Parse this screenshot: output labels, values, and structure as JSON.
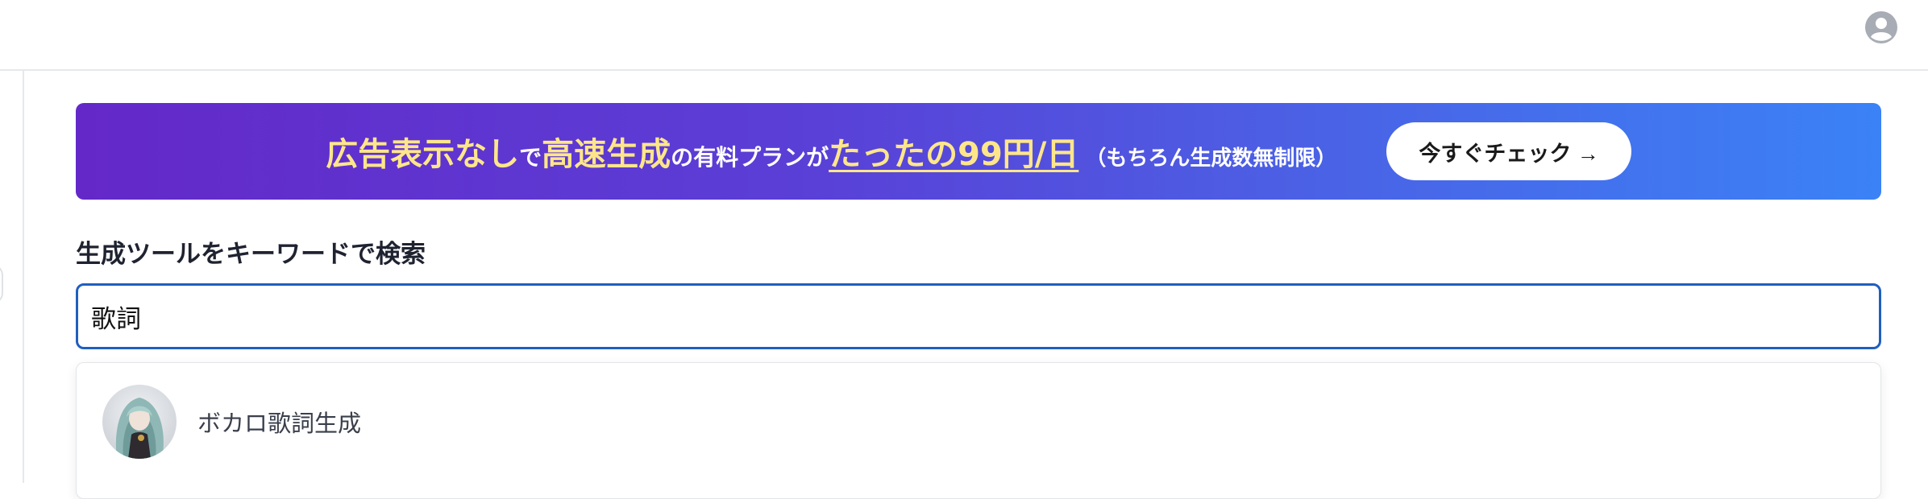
{
  "promo_banner": {
    "part1": "広告表示なし",
    "part2": "で",
    "part3": "高速生成",
    "part4": "の有料プランが",
    "price": "たったの99円/日",
    "note": "（もちろん生成数無制限）",
    "cta_label": "今すぐチェック →"
  },
  "search": {
    "label": "生成ツールをキーワードで検索",
    "value": "歌詞"
  },
  "results": [
    {
      "label": "ボカロ歌詞生成",
      "icon": "character-avatar"
    }
  ],
  "header": {
    "account_icon": "user-circle-icon"
  },
  "colors": {
    "accent_yellow": "#fde68a",
    "banner_start": "#6428c8",
    "banner_end": "#3b82f6",
    "input_border": "#1f5fbf"
  }
}
